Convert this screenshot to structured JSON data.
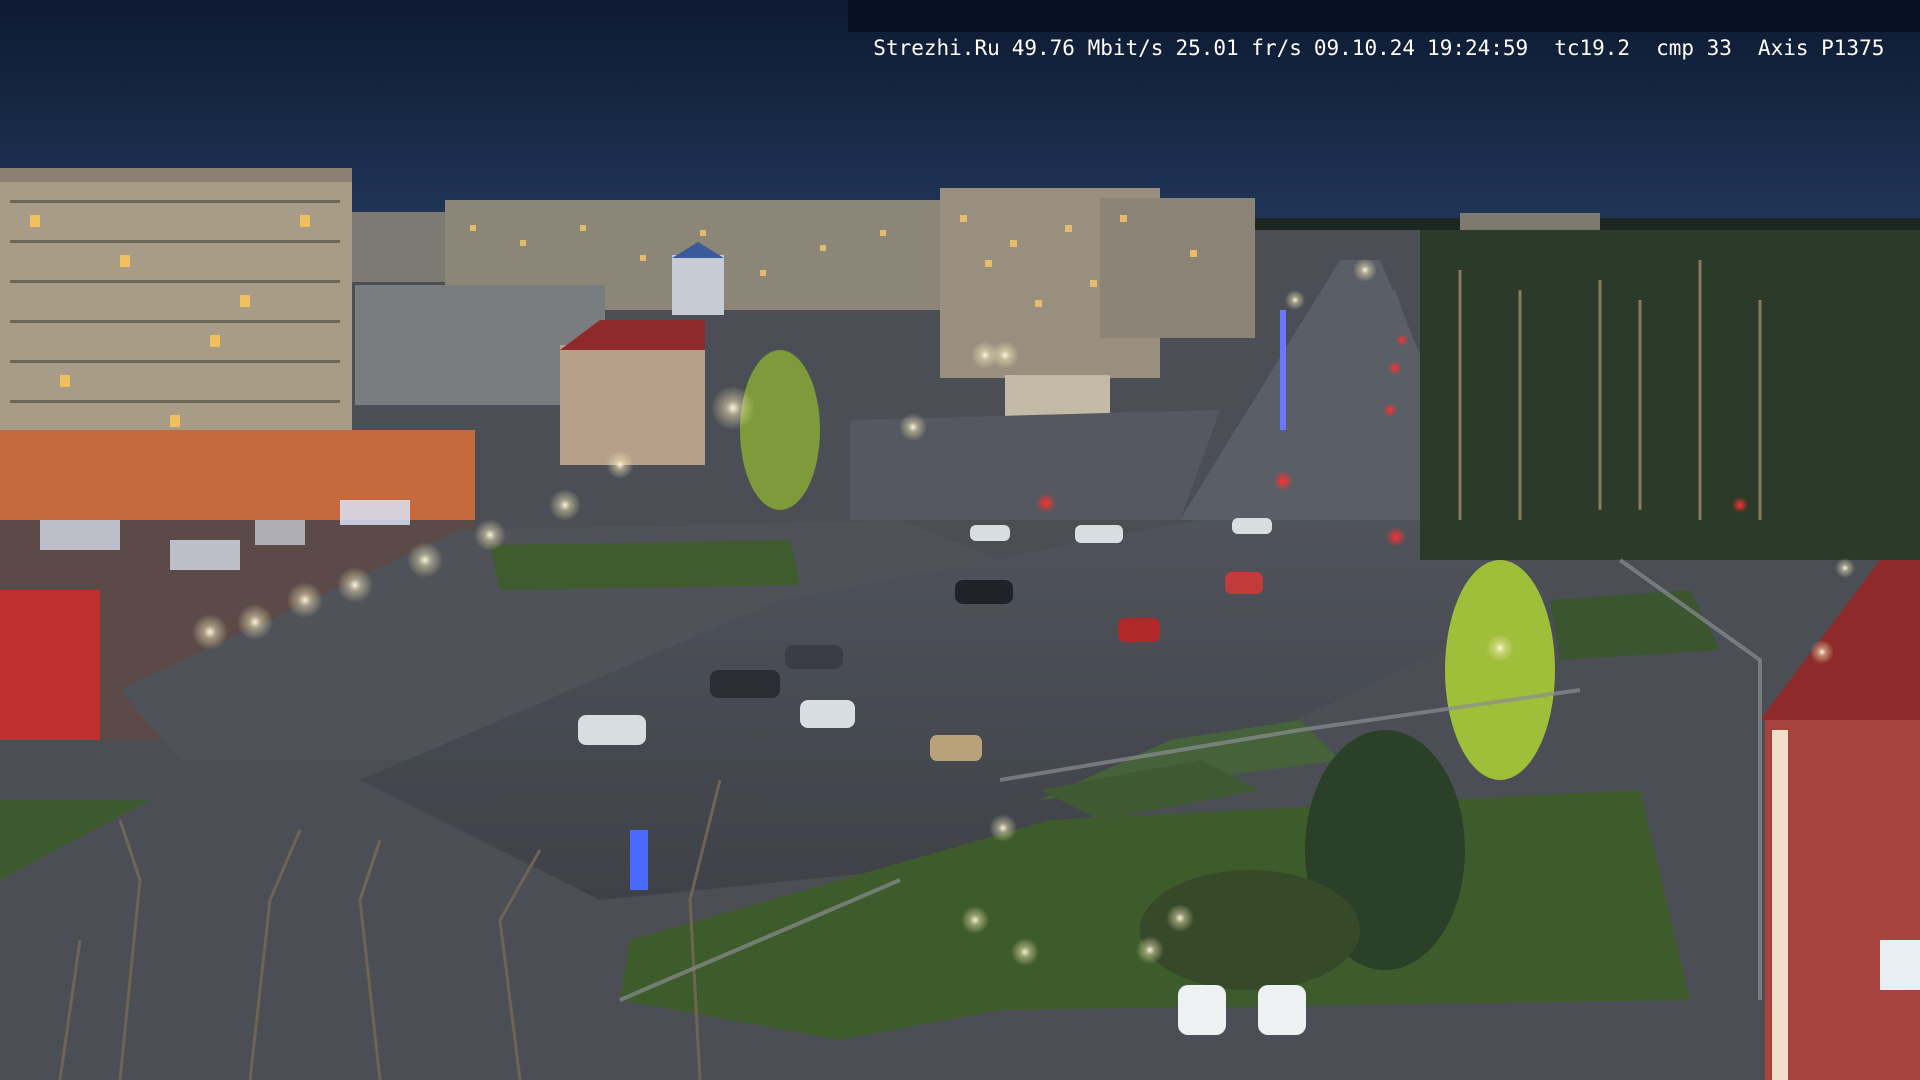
{
  "overlay": {
    "site": "Strezhi.Ru",
    "bitrate": "49.76 Mbit/s",
    "fps": "25.01 fr/s",
    "date": "09.10.24",
    "time": "19:24:59",
    "tc": "tc19.2",
    "cmp": "cmp 33",
    "camera": "Axis P1375"
  },
  "colors": {
    "sky_top": "#0e1c34",
    "sky_horizon": "#1e3357",
    "road": "#4a4e56",
    "grass": "#3d5a2e",
    "building_beige": "#a89c86",
    "store_facade": "#c46a3c",
    "red_roof": "#8e2a2a",
    "streetlight": "#fff6d8",
    "taillight": "#ff2a2a",
    "overlay_text": "#ffffff"
  }
}
